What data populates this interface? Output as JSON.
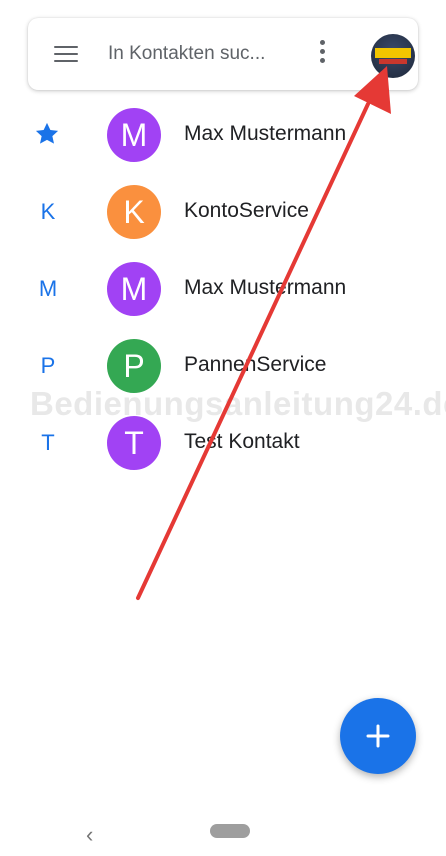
{
  "search": {
    "placeholder": "In Kontakten suc..."
  },
  "contacts": [
    {
      "section": "star",
      "initial": "M",
      "name": "Max Mustermann",
      "avatar_color": "#a142f4"
    },
    {
      "section": "K",
      "initial": "K",
      "name": "KontoService",
      "avatar_color": "#fa903e"
    },
    {
      "section": "M",
      "initial": "M",
      "name": "Max Mustermann",
      "avatar_color": "#a142f4"
    },
    {
      "section": "P",
      "initial": "P",
      "name": "PannenService",
      "avatar_color": "#34a853"
    },
    {
      "section": "T",
      "initial": "T",
      "name": "Test Kontakt",
      "avatar_color": "#a142f4"
    }
  ],
  "watermark": "Bedienungsanleitung24.de",
  "fab": {
    "icon": "plus-icon"
  },
  "nav": {
    "back_icon": "‹"
  },
  "colors": {
    "accent": "#1a73e8",
    "arrow": "#e53935"
  }
}
